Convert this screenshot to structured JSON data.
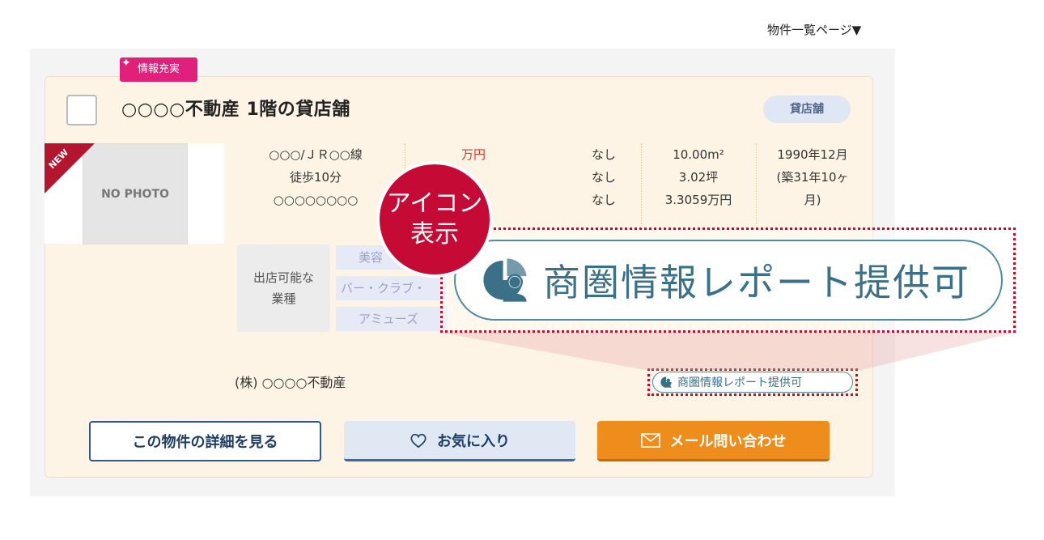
{
  "page_label": "物件一覧ページ▼",
  "badge": "情報充実",
  "title": "○○○○不動産 1階の貸店舗",
  "type_pill": "貸店舗",
  "new_label": "NEW",
  "photo_label": "NO PHOTO",
  "access": [
    "○○○/ＪＲ○○線",
    "徒歩10分",
    "○○○○○○○○"
  ],
  "price": "万円",
  "fees": [
    "なし",
    "なし",
    "なし"
  ],
  "area": [
    "10.00m²",
    "3.02坪",
    "3.3059万円"
  ],
  "built": [
    "1990年12月",
    "(築31年10ヶ",
    "月)"
  ],
  "business_label_1": "出店可能な",
  "business_label_2": "業種",
  "business_tags": [
    "美容",
    "バー・クラブ・",
    "アミューズ"
  ],
  "company": "(株) ○○○○不動産",
  "report_label": "商圏情報レポート提供可",
  "callout_line1": "アイコン",
  "callout_line2": "表示",
  "buttons": {
    "detail": "この物件の詳細を見る",
    "favorite": "お気に入り",
    "mail": "メール問い合わせ"
  },
  "colors": {
    "accent_red": "#c50a35",
    "report_blue": "#3a7188",
    "mail_orange": "#ef8d1c",
    "badge_pink": "#e0207a"
  }
}
